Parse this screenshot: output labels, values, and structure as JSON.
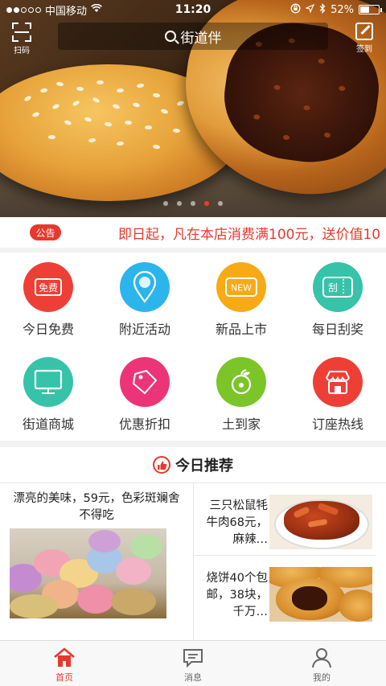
{
  "status_bar": {
    "carrier": "中国移动",
    "time": "11:20",
    "battery": "52%"
  },
  "top_bar": {
    "scan_label": "扫码",
    "search_text": "街道伴",
    "checkin_label": "签到"
  },
  "carousel": {
    "page_count": 5,
    "active_page": 4
  },
  "notice": {
    "badge": "公告",
    "text": "即日起，凡在本店消费满100元，送价值10"
  },
  "categories": [
    {
      "label": "今日免费",
      "icon": "free-ticket-icon",
      "color": "#ee3f36"
    },
    {
      "label": "附近活动",
      "icon": "location-pin-icon",
      "color": "#2bb5ec"
    },
    {
      "label": "新品上市",
      "icon": "new-badge-icon",
      "color": "#f7aa16"
    },
    {
      "label": "每日刮奖",
      "icon": "scratch-card-icon",
      "color": "#37c2aa"
    },
    {
      "label": "街道商城",
      "icon": "monitor-icon",
      "color": "#37c2aa"
    },
    {
      "label": "优惠折扣",
      "icon": "price-tag-icon",
      "color": "#ec3577"
    },
    {
      "label": "土到家",
      "icon": "apple-icon",
      "color": "#7cc528"
    },
    {
      "label": "订座热线",
      "icon": "store-icon",
      "color": "#ee3f36"
    }
  ],
  "recommend": {
    "title": "今日推荐",
    "left": {
      "text": "漂亮的美味，59元，色彩斑斓舍不得吃"
    },
    "right": [
      {
        "text": "三只松鼠牦牛肉68元，麻辣…"
      },
      {
        "text": "烧饼40个包邮，38块，千万…"
      }
    ]
  },
  "tab_bar": {
    "tabs": [
      {
        "label": "首页",
        "icon": "home-icon",
        "active": true
      },
      {
        "label": "消息",
        "icon": "message-icon",
        "active": false
      },
      {
        "label": "我的",
        "icon": "user-icon",
        "active": false
      }
    ]
  },
  "colors": {
    "accent": "#e8382d"
  }
}
